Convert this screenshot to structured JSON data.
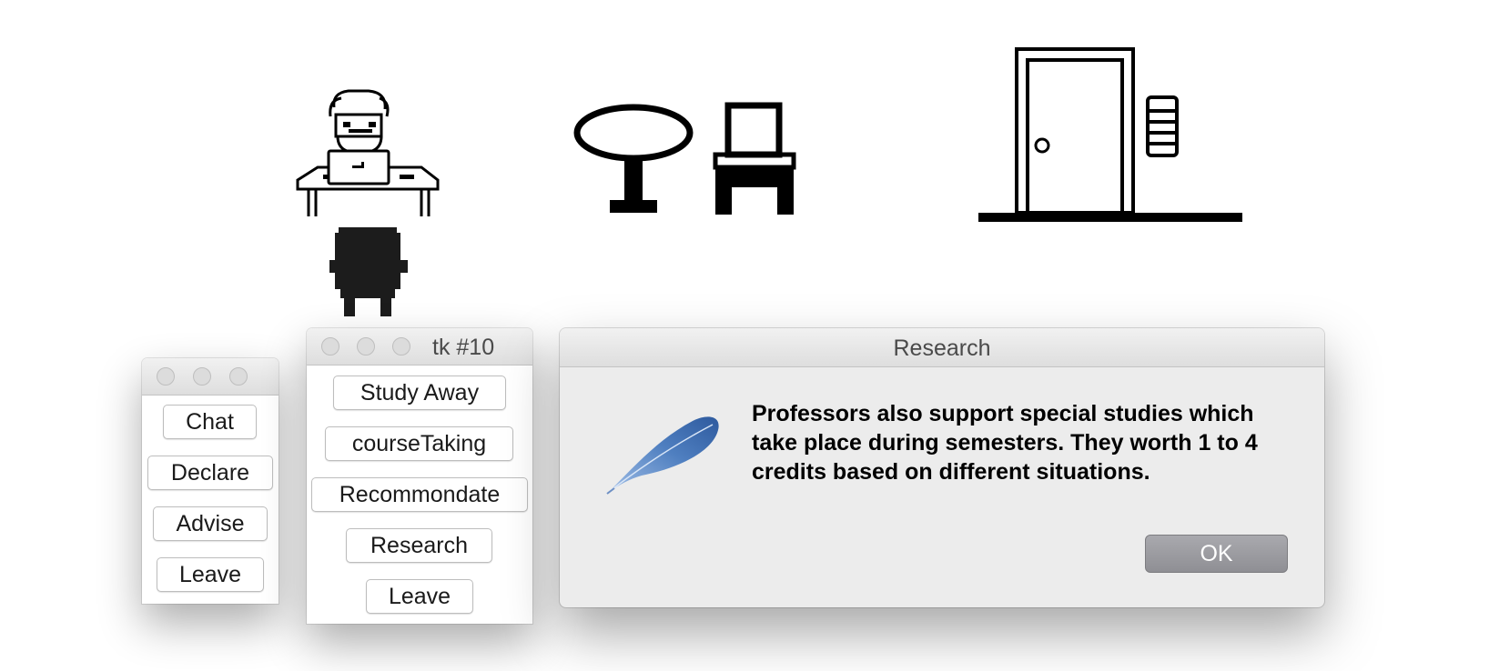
{
  "scene": {
    "sprites": [
      "professor-at-desk",
      "student",
      "round-table",
      "chair",
      "door",
      "intercom"
    ]
  },
  "small_window": {
    "buttons": [
      "Chat",
      "Declare",
      "Advise",
      "Leave"
    ]
  },
  "tk_window": {
    "title": "tk #10",
    "buttons": [
      "Study Away",
      "courseTaking",
      "Recommondate",
      "Research",
      "Leave"
    ]
  },
  "dialog": {
    "title": "Research",
    "message": "Professors also support special studies which take place during semesters. They worth 1 to 4 credits based on different situations.",
    "ok_label": "OK",
    "icon": "feather-icon"
  },
  "colors": {
    "ok_button": "#98989d",
    "dialog_background": "#ececec",
    "feather": "#4a78b8"
  }
}
